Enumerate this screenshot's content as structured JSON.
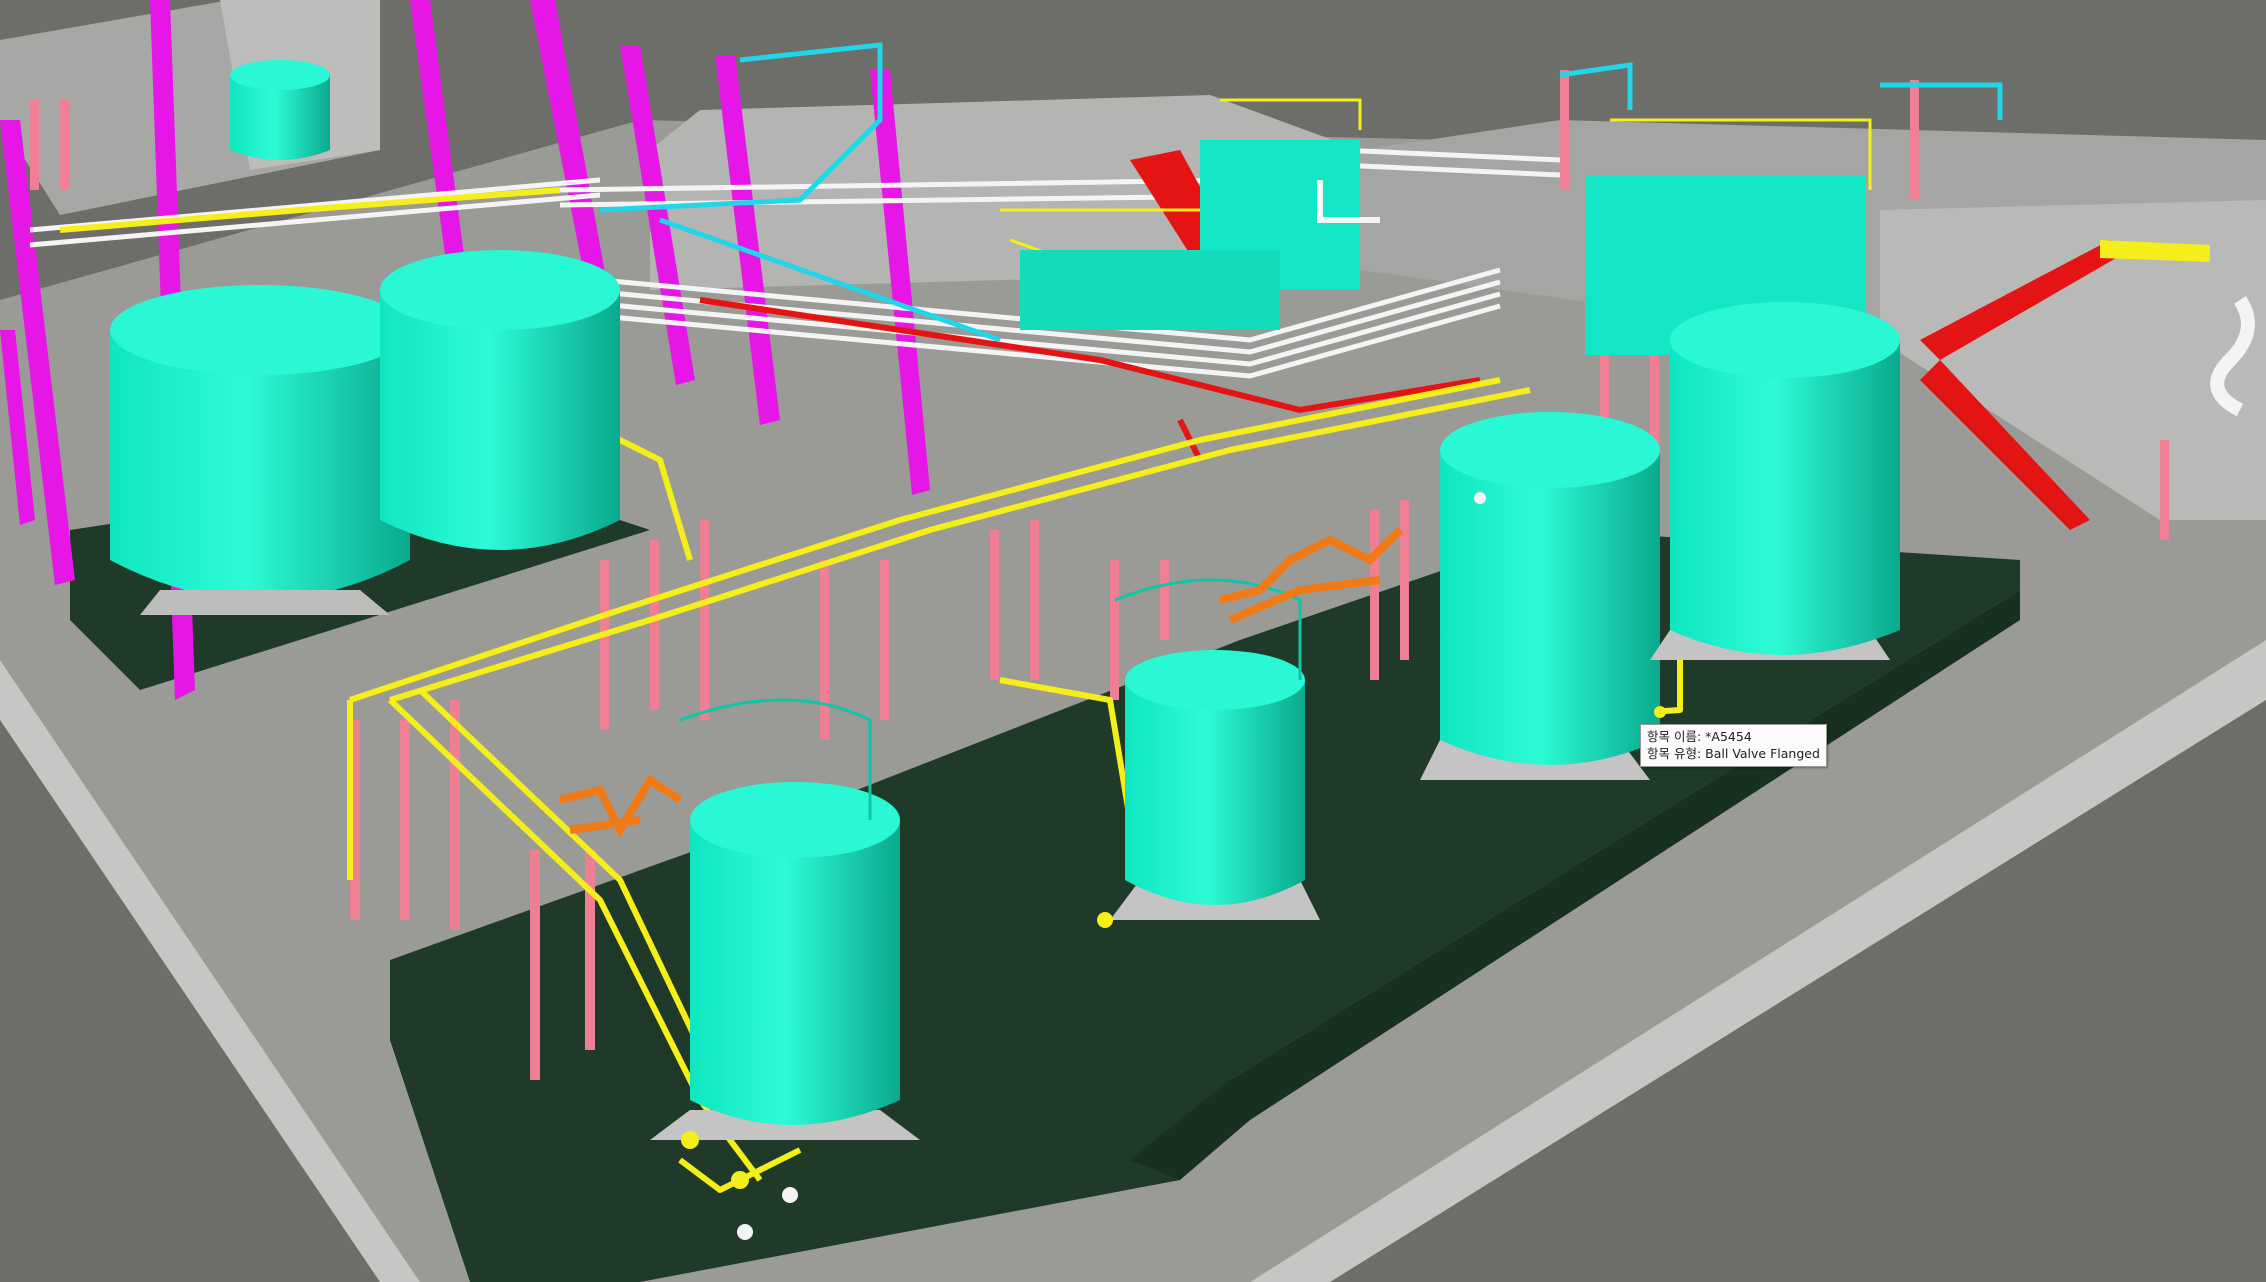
{
  "viewer": {
    "background_color": "#6d6d69",
    "colors": {
      "tank": "#11f2c8",
      "tank_shade": "#0aa98d",
      "concrete": "#a9a9a9",
      "concrete_light": "#c4c4c4",
      "dike_floor": "#1f3a28",
      "piping_yellow": "#f4ee1a",
      "piping_pink": "#ef7f93",
      "column_magenta": "#e616e6",
      "stairs_red": "#e51414",
      "piping_orange": "#f07a16",
      "piping_white": "#f4f4f4"
    },
    "tooltip": {
      "name_line": "항목 이름: *A5454",
      "type_line": "항목 유형: Ball Valve Flanged"
    }
  }
}
